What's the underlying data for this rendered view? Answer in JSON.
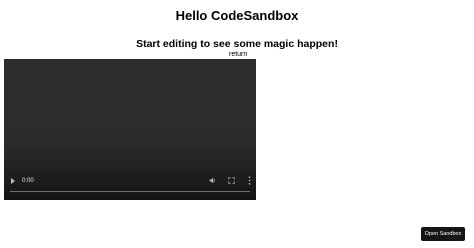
{
  "app": {
    "title": "Hello CodeSandbox",
    "subtitle": "Start editing to see some magic happen!",
    "return_label": "return"
  },
  "video": {
    "current_time": "0:00",
    "icons": [
      "play-icon",
      "volume-icon",
      "fullscreen-icon",
      "more-options-icon"
    ]
  },
  "footer": {
    "open_sandbox_label": "Open Sandbox"
  }
}
